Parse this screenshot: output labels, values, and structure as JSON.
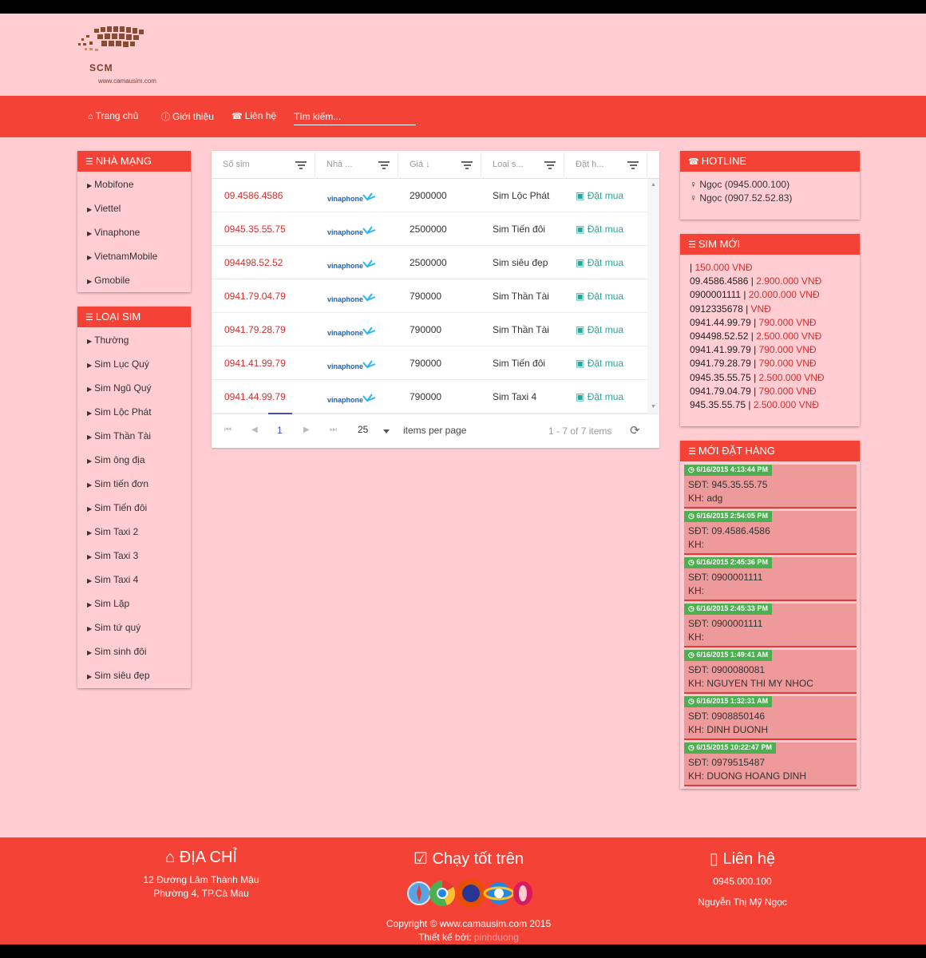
{
  "logo": {
    "name": "SCM",
    "url": "www.camausim.com"
  },
  "nav": {
    "home": "Trang chủ",
    "about": "Giới thiệu",
    "contact": "Liên hệ",
    "search_placeholder": "Tìm kiếm..."
  },
  "networks": {
    "title": "NHÀ MẠNG",
    "items": [
      "Mobifone",
      "Viettel",
      "Vinaphone",
      "VietnamMobile",
      "Gmobile"
    ]
  },
  "simtypes": {
    "title": "LOẠI SIM",
    "items": [
      "Thường",
      "Sim Lục Quý",
      "Sim Ngũ Quý",
      "Sim Lộc Phát",
      "Sim Thần Tài",
      "Sim ông địa",
      "Sim tiến đơn",
      "Sim Tiến đôi",
      "Sim Taxi 2",
      "Sim Taxi 3",
      "Sim Taxi 4",
      "Sim Lặp",
      "Sim tứ quý",
      "Sim sinh đôi",
      "Sim siêu đẹp"
    ]
  },
  "grid": {
    "columns": [
      "Số sim",
      "Nhà ...",
      "Giá ↓",
      "Loại s...",
      "Đặt h..."
    ],
    "carrier_logo": "vinaphone",
    "order_label": "Đặt mua",
    "rows": [
      {
        "num": "09.4586.4586",
        "price": "2900000",
        "type": "Sim Lộc Phát"
      },
      {
        "num": "0945.35.55.75",
        "price": "2500000",
        "type": "Sim Tiến đôi"
      },
      {
        "num": "094498.52.52",
        "price": "2500000",
        "type": "Sim siêu đẹp"
      },
      {
        "num": "0941.79.04.79",
        "price": "790000",
        "type": "Sim Thần Tài"
      },
      {
        "num": "0941.79.28.79",
        "price": "790000",
        "type": "Sim Thần Tài"
      },
      {
        "num": "0941.41.99.79",
        "price": "790000",
        "type": "Sim Tiến đôi"
      },
      {
        "num": "0941.44.99.79",
        "price": "790000",
        "type": "Sim Taxi 4"
      }
    ],
    "pager": {
      "page": "1",
      "page_size": "25",
      "per_page_label": "items per page",
      "info": "1 - 7 of 7 items"
    }
  },
  "hotline": {
    "title": "HOTLINE",
    "lines": [
      "Ngọc (0945.000.100)",
      "Ngọc (0907.52.52.83)"
    ]
  },
  "newsims": {
    "title": "SIM MỚI",
    "items": [
      {
        "num": "",
        "price": "150.000 VNĐ"
      },
      {
        "num": "09.4586.4586",
        "price": "2.900.000 VNĐ"
      },
      {
        "num": "0900001111",
        "price": "20.000.000 VNĐ"
      },
      {
        "num": "0912335678",
        "price": "VNĐ"
      },
      {
        "num": "0941.44.99.79",
        "price": "790.000 VNĐ"
      },
      {
        "num": "094498.52.52",
        "price": "2.500.000 VNĐ"
      },
      {
        "num": "0941.41.99.79",
        "price": "790.000 VNĐ"
      },
      {
        "num": "0941.79.28.79",
        "price": "790.000 VNĐ"
      },
      {
        "num": "0945.35.55.75",
        "price": "2.500.000 VNĐ"
      },
      {
        "num": "0941.79.04.79",
        "price": "790.000 VNĐ"
      },
      {
        "num": "945.35.55.75",
        "price": "2.500.000 VNĐ"
      }
    ]
  },
  "orders": {
    "title": "MỚI ĐẶT HÀNG",
    "items": [
      {
        "time": "6/16/2015 4:13:44 PM",
        "phone": "SĐT: 945.35.55.75",
        "customer": "KH: adg"
      },
      {
        "time": "6/16/2015 2:54:05 PM",
        "phone": "SĐT: 09.4586.4586",
        "customer": "KH:"
      },
      {
        "time": "6/16/2015 2:45:36 PM",
        "phone": "SĐT: 0900001111",
        "customer": "KH:"
      },
      {
        "time": "6/16/2015 2:45:33 PM",
        "phone": "SĐT: 0900001111",
        "customer": "KH:"
      },
      {
        "time": "6/16/2015 1:49:41 AM",
        "phone": "SĐT: 0900080081",
        "customer": "KH: NGUYEN THI MY NHOC"
      },
      {
        "time": "6/16/2015 1:32:31 AM",
        "phone": "SĐT: 0908850146",
        "customer": "KH: DINH DUONH"
      },
      {
        "time": "6/15/2015 10:22:47 PM",
        "phone": "SĐT: 0979515487",
        "customer": "KH: DUONG HOANG DINH"
      }
    ]
  },
  "footer": {
    "address_title": "ĐỊA CHỈ",
    "address_line1": "12 Đường Lâm Thành Mậu",
    "address_line2": "Phường 4, TP.Cà Mau",
    "browsers_title": "Chạy tốt trên",
    "contact_title": "Liên hệ",
    "contact_phone": "0945.000.100",
    "contact_name": "Nguyễn Thị Mỹ Ngọc",
    "copyright": "Copyright © www.camausim.com 2015",
    "designer_label": "Thiết kế bởi:",
    "designer_name": "pinhduong"
  },
  "colors": {
    "primary": "#f44336",
    "background": "#ffcdd2",
    "price": "#d32f2f",
    "order": "#26a69a",
    "badge": "#4caf50"
  }
}
